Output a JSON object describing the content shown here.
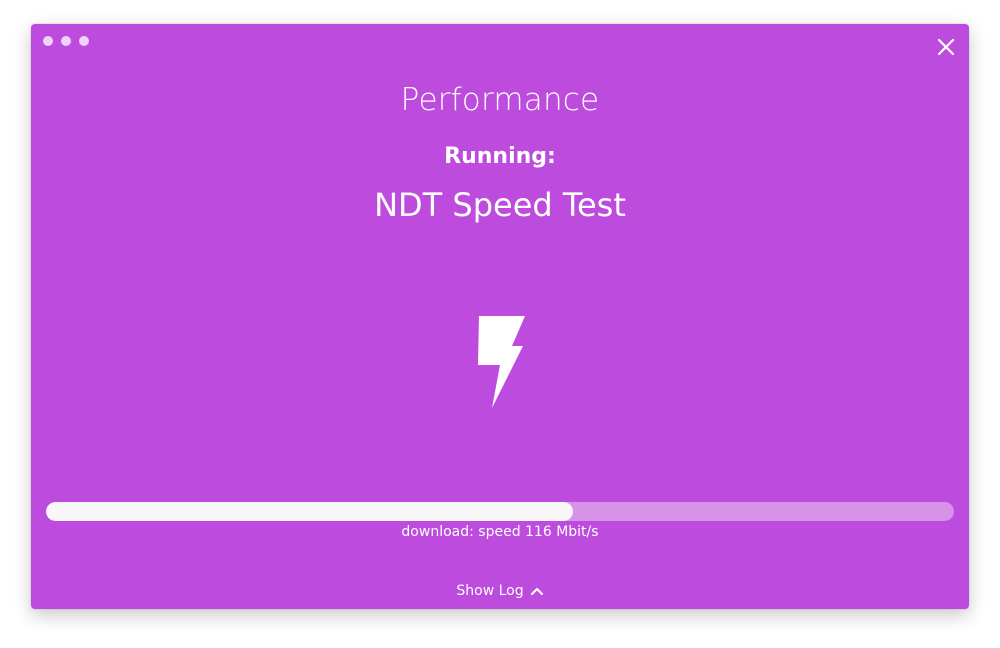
{
  "window": {
    "title": "Performance",
    "running_label": "Running:",
    "test_name": "NDT Speed Test"
  },
  "progress": {
    "fraction": 0.58,
    "status_text": "download: speed 116 Mbit/s"
  },
  "footer": {
    "show_log_label": "Show Log"
  },
  "icons": {
    "main": "lightning-bolt-icon",
    "close": "close-icon",
    "toggle": "chevron-up-icon"
  },
  "colors": {
    "background": "#bd4bdd",
    "foreground": "#ffffff"
  }
}
